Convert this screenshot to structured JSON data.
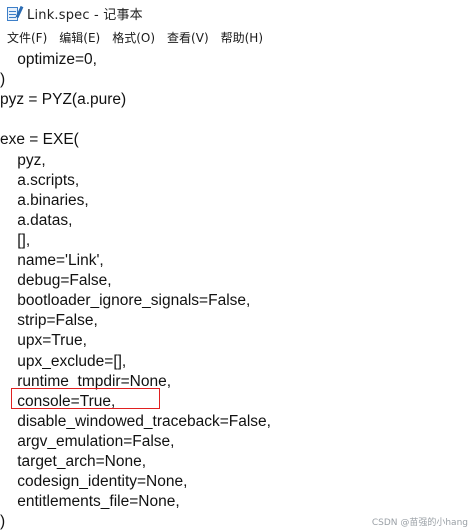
{
  "window": {
    "title": "Link.spec - 记事本"
  },
  "menu": {
    "items": [
      "文件(F)",
      "编辑(E)",
      "格式(O)",
      "查看(V)",
      "帮助(H)"
    ]
  },
  "editor": {
    "lines": [
      "    optimize=0,",
      ")",
      "pyz = PYZ(a.pure)",
      "",
      "exe = EXE(",
      "    pyz,",
      "    a.scripts,",
      "    a.binaries,",
      "    a.datas,",
      "    [],",
      "    name='Link',",
      "    debug=False,",
      "    bootloader_ignore_signals=False,",
      "    strip=False,",
      "    upx=True,",
      "    upx_exclude=[],",
      "    runtime_tmpdir=None,",
      "    console=True,",
      "    disable_windowed_traceback=False,",
      "    argv_emulation=False,",
      "    target_arch=None,",
      "    codesign_identity=None,",
      "    entitlements_file=None,",
      ")"
    ],
    "highlighted_line": "    console=True,",
    "highlight_color": "#e02020"
  },
  "watermark": {
    "text": "CSDN @苗强的小hang"
  },
  "icons": {
    "app": "notepad-icon"
  }
}
